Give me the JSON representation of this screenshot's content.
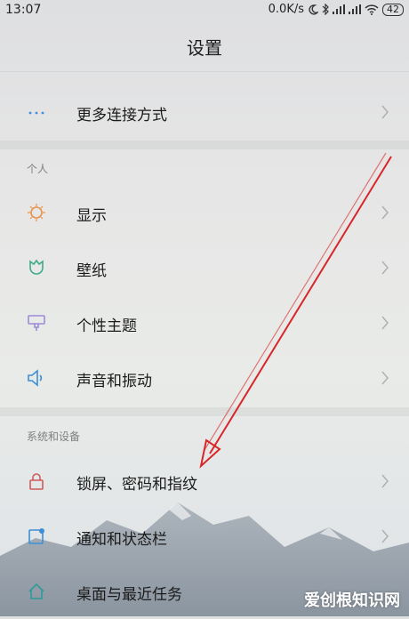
{
  "status_bar": {
    "time": "13:07",
    "speed": "0.0K/s",
    "battery": "42"
  },
  "title": "设置",
  "top_item": {
    "label": "更多连接方式",
    "icon": "more-dots-icon"
  },
  "sections": [
    {
      "header": "个人",
      "items": [
        {
          "label": "显示",
          "icon": "sun-icon"
        },
        {
          "label": "壁纸",
          "icon": "tulip-icon"
        },
        {
          "label": "个性主题",
          "icon": "brush-icon"
        },
        {
          "label": "声音和振动",
          "icon": "speaker-icon"
        }
      ]
    },
    {
      "header": "系统和设备",
      "items": [
        {
          "label": "锁屏、密码和指纹",
          "icon": "lock-icon"
        },
        {
          "label": "通知和状态栏",
          "icon": "notification-icon"
        },
        {
          "label": "桌面与最近任务",
          "icon": "home-icon"
        }
      ]
    }
  ],
  "watermark": "爱创根知识网",
  "colors": {
    "icon_orange": "#e8924a",
    "icon_green": "#3dab8a",
    "icon_purple": "#9e8ad6",
    "icon_blue": "#3c8fd6",
    "icon_lock": "#d05a5a",
    "icon_teal": "#2f9a9a",
    "arrow_red": "#d8262a"
  }
}
